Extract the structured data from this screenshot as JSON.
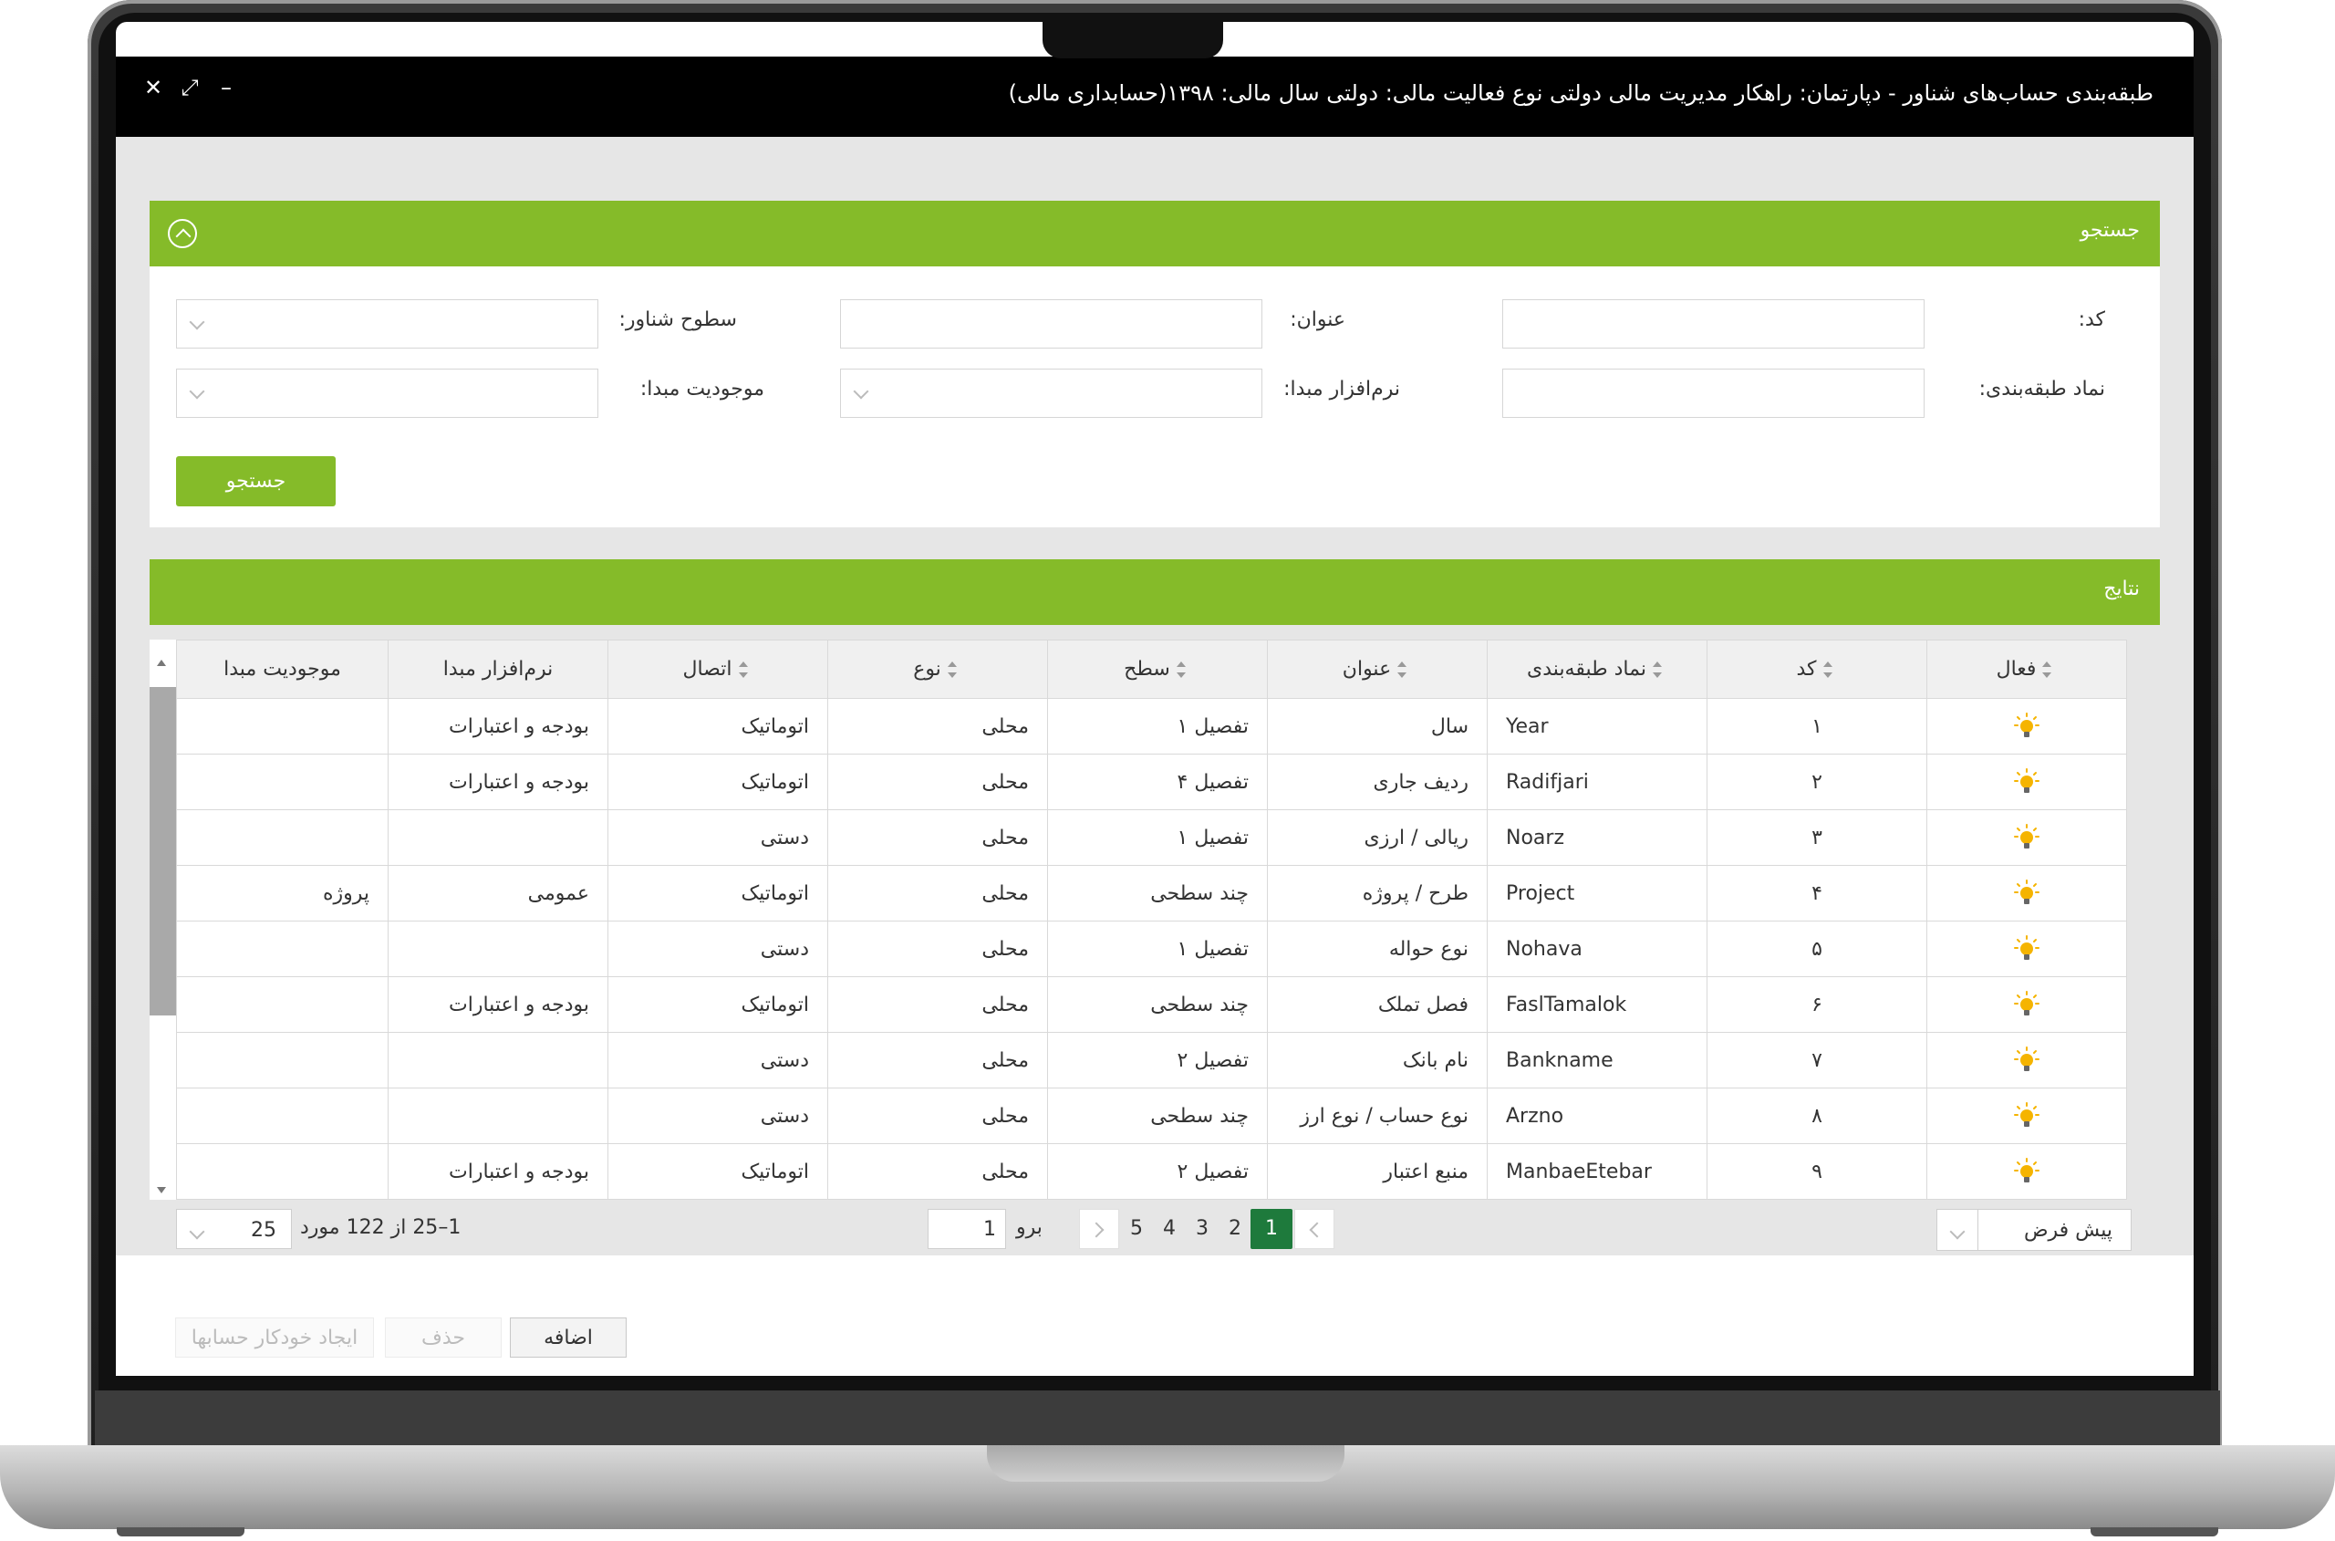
{
  "window": {
    "title": "طبقه‌بندی حساب‌های شناور - دپارتمان: راهکار مدیریت مالی دولتی نوع فعالیت مالی: دولتی سال مالی: ۱۳۹۸(حسابداری مالی)",
    "close_glyph": "✕",
    "expand_glyph": "⤢",
    "minimize_glyph": "–"
  },
  "search": {
    "title": "جستجو",
    "fields": {
      "code_label": "کد:",
      "title_label": "عنوان:",
      "levels_label": "سطوح شناور:",
      "symbol_label": "نماد طبقه‌بندی:",
      "software_label": "نرم‌افزار مبدا:",
      "entity_label": "موجودیت مبدا:"
    },
    "button": "جستجو"
  },
  "results": {
    "title": "نتایج",
    "columns": [
      "فعال",
      "کد",
      "نماد طبقه‌بندی",
      "عنوان",
      "سطح",
      "نوع",
      "اتصال",
      "نرم‌افزار مبدا",
      "موجودیت مبدا"
    ],
    "rows": [
      {
        "code": "۱",
        "symbol": "Year",
        "title": "سال",
        "level": "تفصیل ۱",
        "type": "محلی",
        "connection": "اتوماتیک",
        "software": "بودجه و اعتبارات",
        "entity": ""
      },
      {
        "code": "۲",
        "symbol": "Radifjari",
        "title": "ردیف جاری",
        "level": "تفصیل ۴",
        "type": "محلی",
        "connection": "اتوماتیک",
        "software": "بودجه و اعتبارات",
        "entity": ""
      },
      {
        "code": "۳",
        "symbol": "Noarz",
        "title": "ریالی / ارزی",
        "level": "تفصیل ۱",
        "type": "محلی",
        "connection": "دستی",
        "software": "",
        "entity": ""
      },
      {
        "code": "۴",
        "symbol": "Project",
        "title": "طرح / پروژه",
        "level": "چند سطحی",
        "type": "محلی",
        "connection": "اتوماتیک",
        "software": "عمومی",
        "entity": "پروژه"
      },
      {
        "code": "۵",
        "symbol": "Nohava",
        "title": "نوع حواله",
        "level": "تفصیل ۱",
        "type": "محلی",
        "connection": "دستی",
        "software": "",
        "entity": ""
      },
      {
        "code": "۶",
        "symbol": "FaslTamalok",
        "title": "فصل تملک",
        "level": "چند سطحی",
        "type": "محلی",
        "connection": "اتوماتیک",
        "software": "بودجه و اعتبارات",
        "entity": ""
      },
      {
        "code": "۷",
        "symbol": "Bankname",
        "title": "نام بانک",
        "level": "تفصیل ۲",
        "type": "محلی",
        "connection": "دستی",
        "software": "",
        "entity": ""
      },
      {
        "code": "۸",
        "symbol": "Arzno",
        "title": "نوع حساب / نوع ارز",
        "level": "چند سطحی",
        "type": "محلی",
        "connection": "دستی",
        "software": "",
        "entity": ""
      },
      {
        "code": "۹",
        "symbol": "ManbaeEtebar",
        "title": "منبع اعتبار",
        "level": "تفصیل ۲",
        "type": "محلی",
        "connection": "اتوماتیک",
        "software": "بودجه و اعتبارات",
        "entity": ""
      }
    ],
    "active_icon": "lightbulb-icon",
    "active_color": "#f5b400"
  },
  "pager": {
    "default_view": "پیش فرض",
    "pages": [
      "1",
      "2",
      "3",
      "4",
      "5"
    ],
    "current_page": "1",
    "goto_label": "برو",
    "goto_value": "1",
    "range_text": "1–25 از 122 مورد",
    "page_size": "25"
  },
  "toolbar": {
    "add": "اضافه",
    "delete": "حذف",
    "auto_create": "ایجاد خودکار حسابها"
  },
  "colors": {
    "accent": "#85bb29",
    "active_page": "#1e7a3c",
    "titlebar": "#000000"
  }
}
